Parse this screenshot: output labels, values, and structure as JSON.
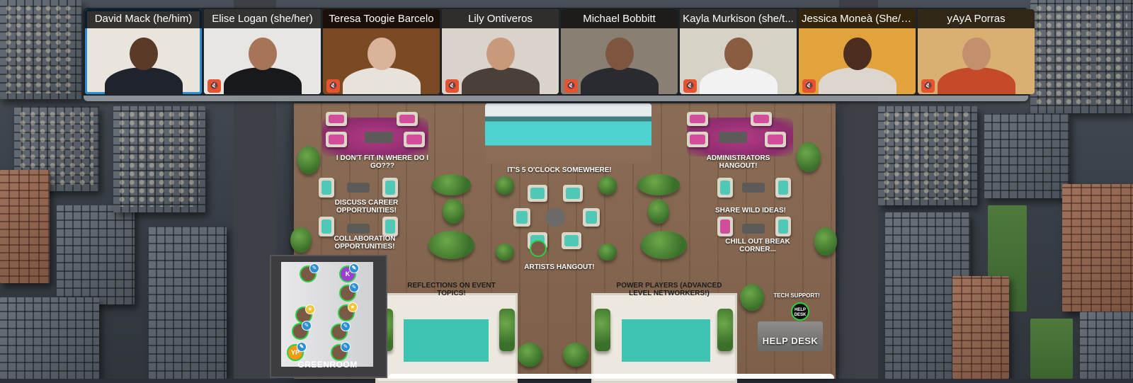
{
  "participants": [
    {
      "name": "David Mack (he/him)",
      "muted": false,
      "active": true,
      "bg": "#e9e4dc",
      "skin": "#5a3a27",
      "shirt": "#1f232b"
    },
    {
      "name": "Elise Logan (she/her)",
      "muted": true,
      "active": false,
      "bg": "#e8e6e2",
      "skin": "#a87458",
      "shirt": "#18191d"
    },
    {
      "name": "Teresa Toogie Barcelo",
      "muted": true,
      "active": false,
      "bg": "#7a4a22",
      "skin": "#d9b39a",
      "shirt": "#e7e2dc"
    },
    {
      "name": "Lily Ontiveros",
      "muted": true,
      "active": false,
      "bg": "#d9d3cc",
      "skin": "#c89a7a",
      "shirt": "#4a4038"
    },
    {
      "name": "Michael Bobbitt",
      "muted": true,
      "active": false,
      "bg": "#8a7f73",
      "skin": "#7e5640",
      "shirt": "#2a2b30"
    },
    {
      "name": "Kayla Murkison (she/t...",
      "muted": true,
      "active": false,
      "bg": "#d7d2c6",
      "skin": "#8a5c40",
      "shirt": "#f2f2f2"
    },
    {
      "name": "Jessica Moneà (She/H...",
      "muted": true,
      "active": false,
      "bg": "#e2a33c",
      "skin": "#4b2e20",
      "shirt": "#dcd6cf"
    },
    {
      "name": "yAyA Porras",
      "muted": true,
      "active": false,
      "bg": "#d9b071",
      "skin": "#c48f6c",
      "shirt": "#c54a2a"
    }
  ],
  "zones": [
    {
      "label": "I DON'T FIT IN WHERE DO I GO???"
    },
    {
      "label": "IT'S 5 O'CLOCK SOMEWHERE!"
    },
    {
      "label": "ADMINISTRATORS HANGOUT!"
    },
    {
      "label": "DISCUSS CAREER OPPORTUNITIES!"
    },
    {
      "label": "SHARE WILD IDEAS!"
    },
    {
      "label": "COLLABORATION OPPORTUNITIES!"
    },
    {
      "label": "CHILL OUT BREAK CORNER..."
    },
    {
      "label": "ARTISTS HANGOUT!"
    },
    {
      "label": "REFLECTIONS ON EVENT TOPICS!"
    },
    {
      "label": "POWER PLAYERS (ADVANCED LEVEL NETWORKERS!)"
    },
    {
      "label": "TECH SUPPORT!"
    }
  ],
  "greenroom": {
    "label": "GREENROOM"
  },
  "helpdesk": {
    "label": "HELP DESK",
    "badge": "HELP DESK"
  },
  "avatars": {
    "k_initial": "K",
    "yp_initial": "YP"
  },
  "colors": {
    "active_border": "#2b8fd4",
    "mute_button": "#e5532f",
    "avatar_ring": "#2bd045",
    "rug_teal": "#3fc3b2"
  }
}
